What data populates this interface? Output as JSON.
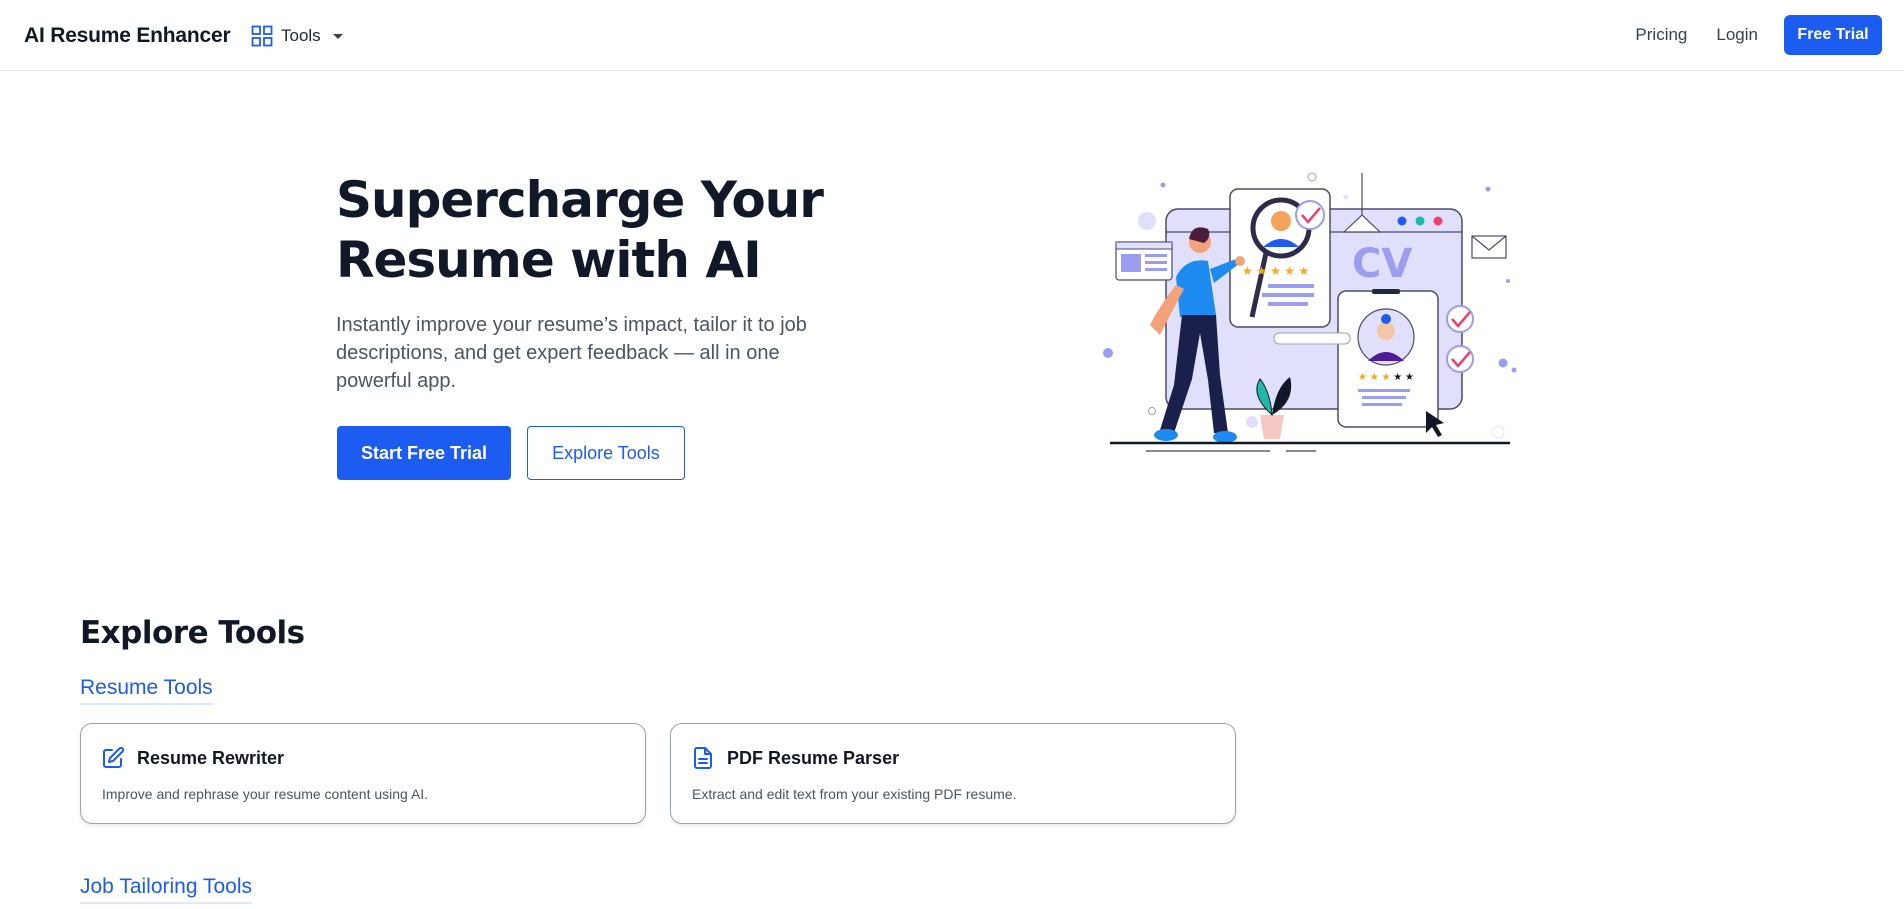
{
  "header": {
    "brand": "AI Resume Enhancer",
    "tools_label": "Tools",
    "pricing_label": "Pricing",
    "login_label": "Login",
    "free_trial_label": "Free Trial"
  },
  "hero": {
    "title": "Supercharge Your Resume with AI",
    "subtitle": "Instantly improve your resume’s impact, tailor it to job descriptions, and get expert feedback — all in one powerful app.",
    "primary_cta": "Start Free Trial",
    "secondary_cta": "Explore Tools",
    "illustration_text": "CV"
  },
  "explore": {
    "title": "Explore Tools",
    "categories": [
      {
        "label": "Resume Tools",
        "cards": [
          {
            "icon": "edit-icon",
            "title": "Resume Rewriter",
            "description": "Improve and rephrase your resume content using AI."
          },
          {
            "icon": "document-icon",
            "title": "PDF Resume Parser",
            "description": "Extract and edit text from your existing PDF resume."
          }
        ]
      },
      {
        "label": "Job Tailoring Tools",
        "cards": []
      }
    ]
  },
  "colors": {
    "accent": "#1d5cf0",
    "heading": "#111827",
    "body_text": "#4b5563",
    "illustration_lavender": "#e0e0fb",
    "illustration_purple": "#9b9ef0"
  }
}
